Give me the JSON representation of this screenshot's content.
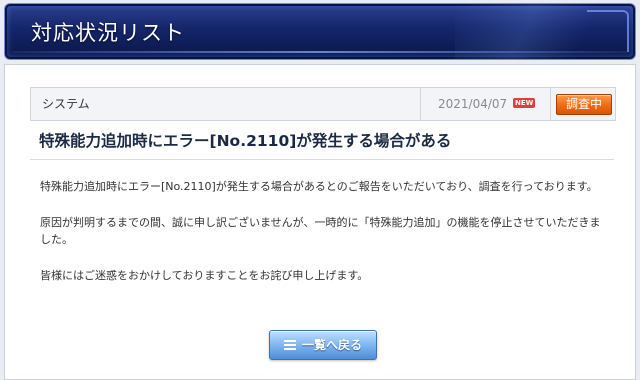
{
  "header": {
    "title": "対応状況リスト"
  },
  "notice": {
    "category": "システム",
    "date": "2021/04/07",
    "new_badge": "NEW",
    "status": "調査中",
    "title": "特殊能力追加時にエラー[No.2110]が発生する場合がある",
    "paragraphs": [
      "特殊能力追加時にエラー[No.2110]が発生する場合があるとのご報告をいただいており、調査を行っております。",
      "原因が判明するまでの間、誠に申し訳ございませんが、一時的に「特殊能力追加」の機能を停止させていただきました。",
      "皆様にはご迷惑をおかけしておりますことをお詫び申し上げます。"
    ]
  },
  "back_button": {
    "label": "一覧へ戻る",
    "icon": "list-icon"
  },
  "colors": {
    "header_bg": "#14256a",
    "status_orange": "#ef6a14",
    "new_red": "#e53b3b",
    "button_blue": "#7fb6f0"
  }
}
